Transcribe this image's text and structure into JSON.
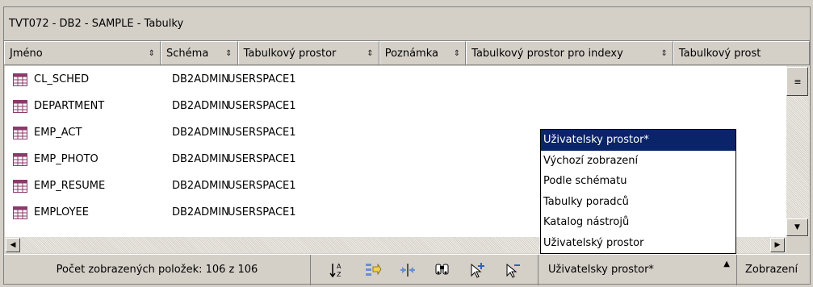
{
  "window": {
    "title": "TVT072 - DB2 - SAMPLE - Tabulky"
  },
  "columns": [
    {
      "label": "Jméno"
    },
    {
      "label": "Schéma"
    },
    {
      "label": "Tabulkový prostor"
    },
    {
      "label": "Poznámka"
    },
    {
      "label": "Tabulkový prostor pro indexy"
    },
    {
      "label": "Tabulkový prost"
    }
  ],
  "rows": [
    {
      "name": "CL_SCHED",
      "schema": "DB2ADMIN",
      "space": "USERSPACE1"
    },
    {
      "name": "DEPARTMENT",
      "schema": "DB2ADMIN",
      "space": "USERSPACE1"
    },
    {
      "name": "EMP_ACT",
      "schema": "DB2ADMIN",
      "space": "USERSPACE1"
    },
    {
      "name": "EMP_PHOTO",
      "schema": "DB2ADMIN",
      "space": "USERSPACE1"
    },
    {
      "name": "EMP_RESUME",
      "schema": "DB2ADMIN",
      "space": "USERSPACE1"
    },
    {
      "name": "EMPLOYEE",
      "schema": "DB2ADMIN",
      "space": "USERSPACE1"
    }
  ],
  "status": {
    "count_text": "Počet zobrazených položek: 106 z 106",
    "view_value": "Uživatelsky prostor*",
    "view_label": "Zobrazení"
  },
  "toolbar_icons": [
    "sort-icon",
    "filter-icon",
    "customize-columns-icon",
    "find-icon",
    "select-all-icon",
    "deselect-all-icon"
  ],
  "view_menu": {
    "selected_index": 0,
    "items": [
      "Uživatelsky prostor*",
      "Výchozí zobrazení",
      "Podle schématu",
      "Tabulky poradců",
      "Katalog nástrojů",
      "Uživatelský prostor"
    ]
  },
  "colors": {
    "selection": "#0a246a",
    "panel": "#d4d0c8",
    "table_icon": "#8b3a6b"
  }
}
